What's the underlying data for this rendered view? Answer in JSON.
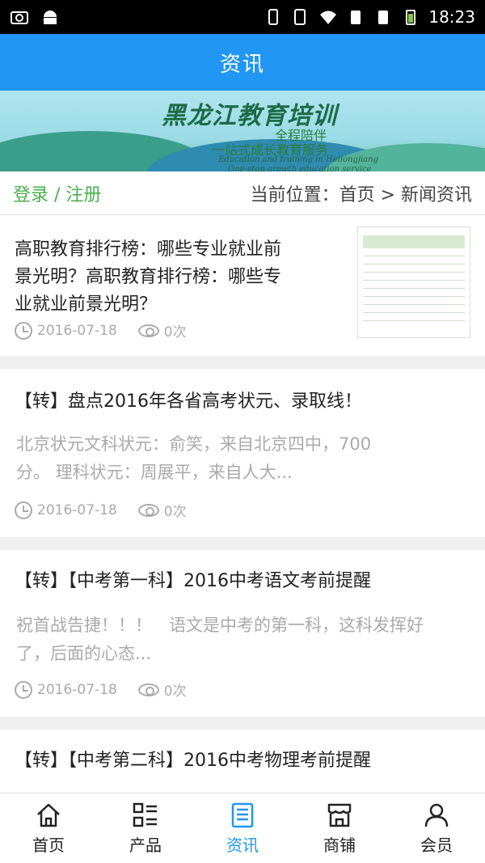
{
  "status_bar": {
    "time": "18:23"
  },
  "header": {
    "title": "资讯"
  },
  "banner": {
    "title": "黑龙江教育培训",
    "tagline_1": "全程陪伴",
    "tagline_2": "一站式成长教育服务",
    "english_1": "Education and training in Heilongjiang",
    "english_2": "One-stop growth education service"
  },
  "crumb_bar": {
    "login_register": "登录 / 注册",
    "location": "当前位置：首页 > 新闻资讯"
  },
  "articles": [
    {
      "title": "高职教育排行榜：哪些专业就业前景光明？高职教育排行榜：哪些专业就业前景光明？",
      "title_lines": [
        "高职教育排行榜：哪些专业就业前",
        "景光明？高职教育排行榜：哪些专",
        "业就业前景光明？"
      ],
      "date": "2016-07-18",
      "views": "0次",
      "has_thumbnail": true
    },
    {
      "title": "【转】盘点2016年各省高考状元、录取线！",
      "desc_lines": [
        "北京状元文科状元：俞笑，来自北京四中，700",
        "分。 理科状元：周展平，来自人大..."
      ],
      "date": "2016-07-18",
      "views": "0次"
    },
    {
      "title": "【转】【中考第一科】2016中考语文考前提醒",
      "desc_lines": [
        " 祝首战告捷！！！　语文是中考的第一科，这科发挥好",
        "了，后面的心态..."
      ],
      "date": "2016-07-18",
      "views": "0次"
    },
    {
      "title": "【转】【中考第二科】2016中考物理考前提醒"
    }
  ],
  "bottom_nav": [
    {
      "label": "首页",
      "icon": "home-icon"
    },
    {
      "label": "产品",
      "icon": "grid-list-icon"
    },
    {
      "label": "资讯",
      "icon": "document-icon",
      "active": true
    },
    {
      "label": "商铺",
      "icon": "store-icon"
    },
    {
      "label": "会员",
      "icon": "user-icon"
    }
  ],
  "colors": {
    "primary": "#2196f3",
    "login_green": "#4caf50"
  }
}
